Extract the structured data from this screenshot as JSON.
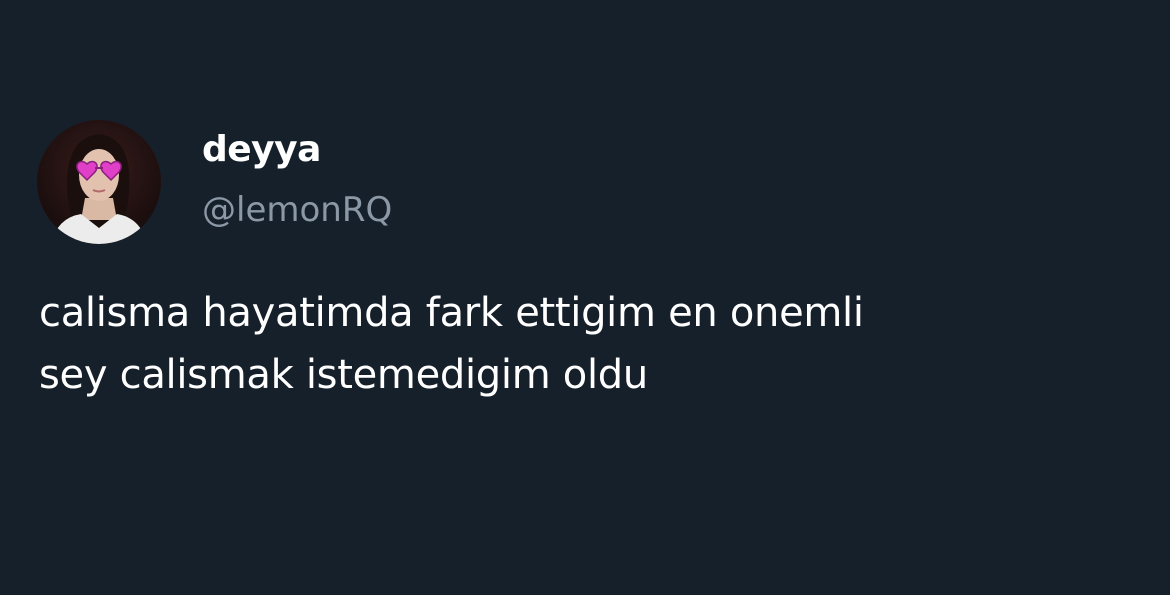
{
  "tweet": {
    "author": {
      "display_name": "deyya",
      "handle": "@lemonRQ",
      "avatar_icon": "profile-photo-heart-sunglasses"
    },
    "text_lines": [
      "calisma hayatimda fark ettigim en onemli",
      "sey calismak istemedigim oldu"
    ]
  },
  "colors": {
    "background": "#16202b",
    "name": "#ffffff",
    "handle": "#8b98a5",
    "text": "#ffffff",
    "sunglasses": "#e040c8"
  }
}
